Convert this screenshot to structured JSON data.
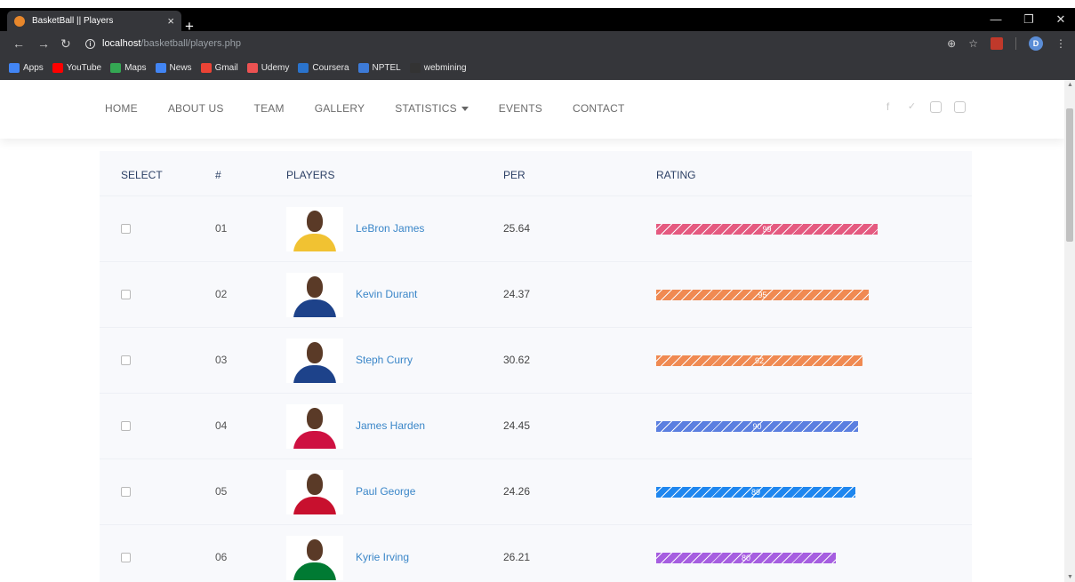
{
  "browser": {
    "tab_title": "BasketBall || Players",
    "tab_close": "×",
    "new_tab": "+",
    "url_host": "localhost",
    "url_path": "/basketball/players.php",
    "avatar_letter": "D",
    "bookmarks": [
      {
        "label": "Apps",
        "color": "#4285f4",
        "icon": "apps-grid-icon"
      },
      {
        "label": "YouTube",
        "color": "#ff0000",
        "icon": "youtube-icon"
      },
      {
        "label": "Maps",
        "color": "#34a853",
        "icon": "maps-icon"
      },
      {
        "label": "News",
        "color": "#4285f4",
        "icon": "news-icon"
      },
      {
        "label": "Gmail",
        "color": "#ea4335",
        "icon": "gmail-icon"
      },
      {
        "label": "Udemy",
        "color": "#ec5252",
        "icon": "udemy-icon"
      },
      {
        "label": "Coursera",
        "color": "#2a73cc",
        "icon": "coursera-icon"
      },
      {
        "label": "NPTEL",
        "color": "#3d7bd8",
        "icon": "nptel-icon"
      },
      {
        "label": "webmining",
        "color": "#333333",
        "icon": "github-icon"
      }
    ]
  },
  "nav": {
    "items": [
      "HOME",
      "ABOUT US",
      "TEAM",
      "GALLERY",
      "STATISTICS",
      "EVENTS",
      "CONTACT"
    ],
    "social_icons": [
      "facebook-icon",
      "twitter-icon",
      "instagram-icon",
      "skype-icon"
    ]
  },
  "table": {
    "headers": {
      "select": "SELECT",
      "num": "#",
      "players": "PLAYERS",
      "per": "PER",
      "rating": "RATING"
    },
    "rows": [
      {
        "num": "01",
        "name": "LeBron James",
        "per": "25.64",
        "rating": "99",
        "rating_fraction": 0.99,
        "bar_color": "#e55a80",
        "jersey_color": "#f1c232"
      },
      {
        "num": "02",
        "name": "Kevin Durant",
        "per": "24.37",
        "rating": "95",
        "rating_fraction": 0.95,
        "bar_color": "#f08a52",
        "jersey_color": "#1d428a"
      },
      {
        "num": "03",
        "name": "Steph Curry",
        "per": "30.62",
        "rating": "92",
        "rating_fraction": 0.92,
        "bar_color": "#f08a52",
        "jersey_color": "#1d428a"
      },
      {
        "num": "04",
        "name": "James Harden",
        "per": "24.45",
        "rating": "90",
        "rating_fraction": 0.9,
        "bar_color": "#5b7fe0",
        "jersey_color": "#ce1141"
      },
      {
        "num": "05",
        "name": "Paul George",
        "per": "24.26",
        "rating": "89",
        "rating_fraction": 0.89,
        "bar_color": "#1f87ef",
        "jersey_color": "#c8102e"
      },
      {
        "num": "06",
        "name": "Kyrie Irving",
        "per": "26.21",
        "rating": "80",
        "rating_fraction": 0.8,
        "bar_color": "#a65ee0",
        "jersey_color": "#007a33"
      }
    ]
  }
}
